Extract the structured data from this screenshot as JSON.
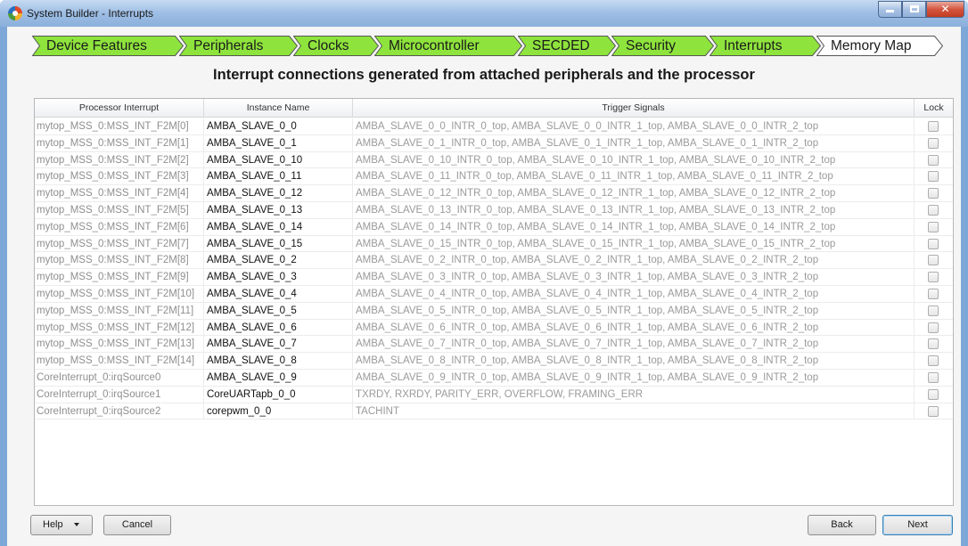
{
  "window": {
    "title": "System Builder - Interrupts"
  },
  "steps": [
    {
      "label": "Device Features",
      "state": "done"
    },
    {
      "label": "Peripherals",
      "state": "done"
    },
    {
      "label": "Clocks",
      "state": "done"
    },
    {
      "label": "Microcontroller",
      "state": "done"
    },
    {
      "label": "SECDED",
      "state": "done"
    },
    {
      "label": "Security",
      "state": "done"
    },
    {
      "label": "Interrupts",
      "state": "current"
    },
    {
      "label": "Memory Map",
      "state": "pending"
    }
  ],
  "colors": {
    "step_done": "#8ee43c",
    "step_pending": "#ffffff",
    "step_border": "#555555"
  },
  "heading": "Interrupt connections generated from attached peripherals and the processor",
  "table": {
    "columns": [
      "Processor Interrupt",
      "Instance Name",
      "Trigger Signals",
      "Lock"
    ],
    "rows": [
      {
        "proc": "mytop_MSS_0:MSS_INT_F2M[0]",
        "inst": "AMBA_SLAVE_0_0",
        "trig": "AMBA_SLAVE_0_0_INTR_0_top, AMBA_SLAVE_0_0_INTR_1_top, AMBA_SLAVE_0_0_INTR_2_top",
        "lock": false
      },
      {
        "proc": "mytop_MSS_0:MSS_INT_F2M[1]",
        "inst": "AMBA_SLAVE_0_1",
        "trig": "AMBA_SLAVE_0_1_INTR_0_top, AMBA_SLAVE_0_1_INTR_1_top, AMBA_SLAVE_0_1_INTR_2_top",
        "lock": false
      },
      {
        "proc": "mytop_MSS_0:MSS_INT_F2M[2]",
        "inst": "AMBA_SLAVE_0_10",
        "trig": "AMBA_SLAVE_0_10_INTR_0_top, AMBA_SLAVE_0_10_INTR_1_top, AMBA_SLAVE_0_10_INTR_2_top",
        "lock": false
      },
      {
        "proc": "mytop_MSS_0:MSS_INT_F2M[3]",
        "inst": "AMBA_SLAVE_0_11",
        "trig": "AMBA_SLAVE_0_11_INTR_0_top, AMBA_SLAVE_0_11_INTR_1_top, AMBA_SLAVE_0_11_INTR_2_top",
        "lock": false
      },
      {
        "proc": "mytop_MSS_0:MSS_INT_F2M[4]",
        "inst": "AMBA_SLAVE_0_12",
        "trig": "AMBA_SLAVE_0_12_INTR_0_top, AMBA_SLAVE_0_12_INTR_1_top, AMBA_SLAVE_0_12_INTR_2_top",
        "lock": false
      },
      {
        "proc": "mytop_MSS_0:MSS_INT_F2M[5]",
        "inst": "AMBA_SLAVE_0_13",
        "trig": "AMBA_SLAVE_0_13_INTR_0_top, AMBA_SLAVE_0_13_INTR_1_top, AMBA_SLAVE_0_13_INTR_2_top",
        "lock": false
      },
      {
        "proc": "mytop_MSS_0:MSS_INT_F2M[6]",
        "inst": "AMBA_SLAVE_0_14",
        "trig": "AMBA_SLAVE_0_14_INTR_0_top, AMBA_SLAVE_0_14_INTR_1_top, AMBA_SLAVE_0_14_INTR_2_top",
        "lock": false
      },
      {
        "proc": "mytop_MSS_0:MSS_INT_F2M[7]",
        "inst": "AMBA_SLAVE_0_15",
        "trig": "AMBA_SLAVE_0_15_INTR_0_top, AMBA_SLAVE_0_15_INTR_1_top, AMBA_SLAVE_0_15_INTR_2_top",
        "lock": false
      },
      {
        "proc": "mytop_MSS_0:MSS_INT_F2M[8]",
        "inst": "AMBA_SLAVE_0_2",
        "trig": "AMBA_SLAVE_0_2_INTR_0_top, AMBA_SLAVE_0_2_INTR_1_top, AMBA_SLAVE_0_2_INTR_2_top",
        "lock": false
      },
      {
        "proc": "mytop_MSS_0:MSS_INT_F2M[9]",
        "inst": "AMBA_SLAVE_0_3",
        "trig": "AMBA_SLAVE_0_3_INTR_0_top, AMBA_SLAVE_0_3_INTR_1_top, AMBA_SLAVE_0_3_INTR_2_top",
        "lock": false
      },
      {
        "proc": "mytop_MSS_0:MSS_INT_F2M[10]",
        "inst": "AMBA_SLAVE_0_4",
        "trig": "AMBA_SLAVE_0_4_INTR_0_top, AMBA_SLAVE_0_4_INTR_1_top, AMBA_SLAVE_0_4_INTR_2_top",
        "lock": false
      },
      {
        "proc": "mytop_MSS_0:MSS_INT_F2M[11]",
        "inst": "AMBA_SLAVE_0_5",
        "trig": "AMBA_SLAVE_0_5_INTR_0_top, AMBA_SLAVE_0_5_INTR_1_top, AMBA_SLAVE_0_5_INTR_2_top",
        "lock": false
      },
      {
        "proc": "mytop_MSS_0:MSS_INT_F2M[12]",
        "inst": "AMBA_SLAVE_0_6",
        "trig": "AMBA_SLAVE_0_6_INTR_0_top, AMBA_SLAVE_0_6_INTR_1_top, AMBA_SLAVE_0_6_INTR_2_top",
        "lock": false
      },
      {
        "proc": "mytop_MSS_0:MSS_INT_F2M[13]",
        "inst": "AMBA_SLAVE_0_7",
        "trig": "AMBA_SLAVE_0_7_INTR_0_top, AMBA_SLAVE_0_7_INTR_1_top, AMBA_SLAVE_0_7_INTR_2_top",
        "lock": false
      },
      {
        "proc": "mytop_MSS_0:MSS_INT_F2M[14]",
        "inst": "AMBA_SLAVE_0_8",
        "trig": "AMBA_SLAVE_0_8_INTR_0_top, AMBA_SLAVE_0_8_INTR_1_top, AMBA_SLAVE_0_8_INTR_2_top",
        "lock": false
      },
      {
        "proc": "CoreInterrupt_0:irqSource0",
        "inst": "AMBA_SLAVE_0_9",
        "trig": "AMBA_SLAVE_0_9_INTR_0_top, AMBA_SLAVE_0_9_INTR_1_top, AMBA_SLAVE_0_9_INTR_2_top",
        "lock": false
      },
      {
        "proc": "CoreInterrupt_0:irqSource1",
        "inst": "CoreUARTapb_0_0",
        "trig": "TXRDY, RXRDY, PARITY_ERR, OVERFLOW, FRAMING_ERR",
        "lock": false
      },
      {
        "proc": "CoreInterrupt_0:irqSource2",
        "inst": "corepwm_0_0",
        "trig": "TACHINT",
        "lock": false
      }
    ]
  },
  "buttons": {
    "help": "Help",
    "cancel": "Cancel",
    "back": "Back",
    "next": "Next"
  }
}
